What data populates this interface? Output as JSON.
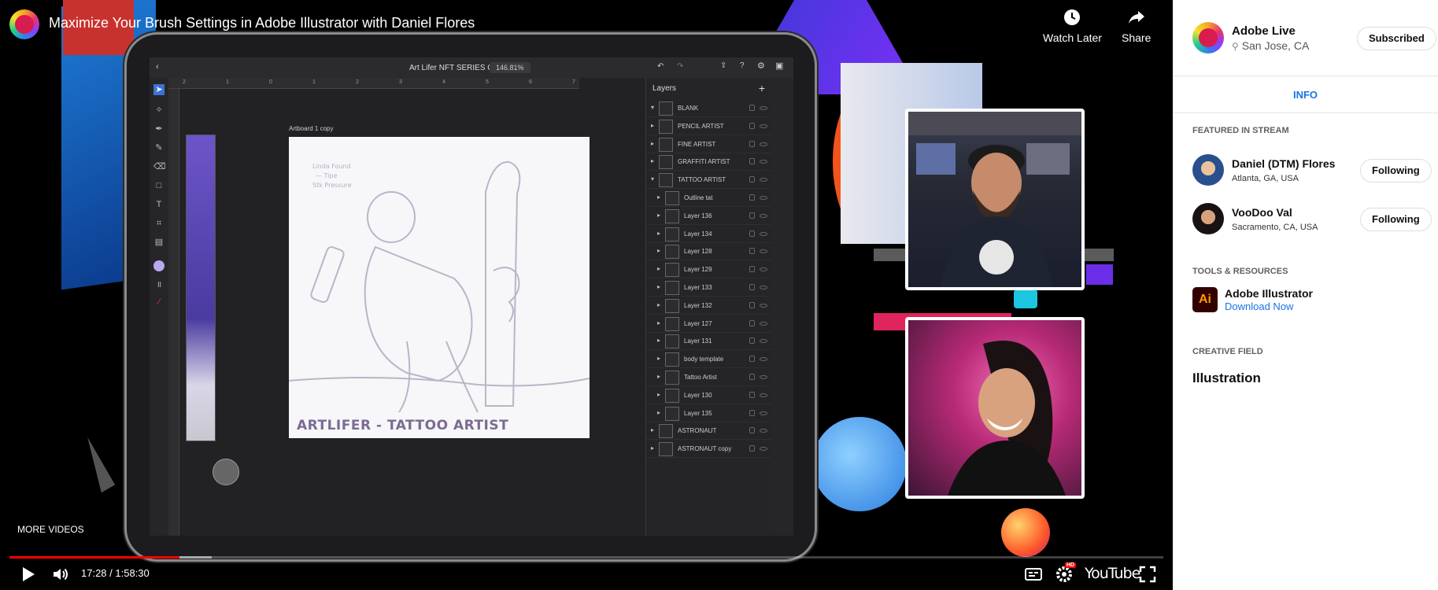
{
  "video": {
    "title": "Maximize Your Brush Settings in Adobe Illustrator with Daniel Flores",
    "watch_later_label": "Watch Later",
    "share_label": "Share",
    "more_videos_label": "MORE VIDEOS",
    "current_time": "17:28",
    "duration": "1:58:30",
    "time_display": "17:28 / 1:58:30",
    "progress_fraction": 0.147,
    "buffer_fraction": 0.175,
    "youtube_label": "YouTube",
    "hd_badge": "HD"
  },
  "tablet_app": {
    "doc_title": "Art Lifer NFT SERIES C",
    "zoom": "146.81%",
    "artboard_label": "Artboard 1 copy",
    "artboard_caption": "ARTLIFER - TATTOO ARTIST",
    "sketch_note_lines": [
      "Linda Found",
      "— Tipe",
      "Stk Pressure"
    ],
    "ruler_ticks": [
      "2",
      "1",
      "0",
      "1",
      "2",
      "3",
      "4",
      "5",
      "6",
      "7"
    ],
    "layers_title": "Layers",
    "layers": [
      {
        "name": "BLANK",
        "level": 0,
        "open": true
      },
      {
        "name": "PENCIL ARTIST",
        "level": 0,
        "open": false
      },
      {
        "name": "FINE ARTIST",
        "level": 0,
        "open": false
      },
      {
        "name": "GRAFFITI ARTIST",
        "level": 0,
        "open": false
      },
      {
        "name": "TATTOO ARTIST",
        "level": 0,
        "open": true
      },
      {
        "name": "Outline tat",
        "level": 1,
        "open": false
      },
      {
        "name": "Layer 136",
        "level": 1,
        "open": false
      },
      {
        "name": "Layer 134",
        "level": 1,
        "open": false
      },
      {
        "name": "Layer 128",
        "level": 1,
        "open": false
      },
      {
        "name": "Layer 129",
        "level": 1,
        "open": false
      },
      {
        "name": "Layer 133",
        "level": 1,
        "open": false
      },
      {
        "name": "Layer 132",
        "level": 1,
        "open": false
      },
      {
        "name": "Layer 127",
        "level": 1,
        "open": false
      },
      {
        "name": "Layer 131",
        "level": 1,
        "open": false
      },
      {
        "name": "body template",
        "level": 1,
        "open": false
      },
      {
        "name": "Tattoo Artist",
        "level": 1,
        "open": false
      },
      {
        "name": "Layer 130",
        "level": 1,
        "open": false
      },
      {
        "name": "Layer 135",
        "level": 1,
        "open": false
      },
      {
        "name": "ASTRONAUT",
        "level": 0,
        "open": false
      },
      {
        "name": "ASTRONAUT copy",
        "level": 0,
        "open": false
      }
    ]
  },
  "sidebar": {
    "channel": {
      "name": "Adobe Live",
      "location": "San Jose, CA",
      "subscribe_label": "Subscribed"
    },
    "tab_info": "INFO",
    "featured_heading": "FEATURED IN STREAM",
    "featured": [
      {
        "name": "Daniel (DTM) Flores",
        "location": "Atlanta, GA, USA",
        "button": "Following"
      },
      {
        "name": "VooDoo Val",
        "location": "Sacramento, CA, USA",
        "button": "Following"
      }
    ],
    "tools_heading": "TOOLS & RESOURCES",
    "tool": {
      "icon_text": "Ai",
      "name": "Adobe Illustrator",
      "link": "Download Now"
    },
    "creative_field_heading": "CREATIVE FIELD",
    "creative_field": "Illustration"
  },
  "colors": {
    "progress": "#ff0000",
    "link": "#1a73e8",
    "illustrator_bg": "#330000",
    "illustrator_fg": "#ff9a00"
  }
}
